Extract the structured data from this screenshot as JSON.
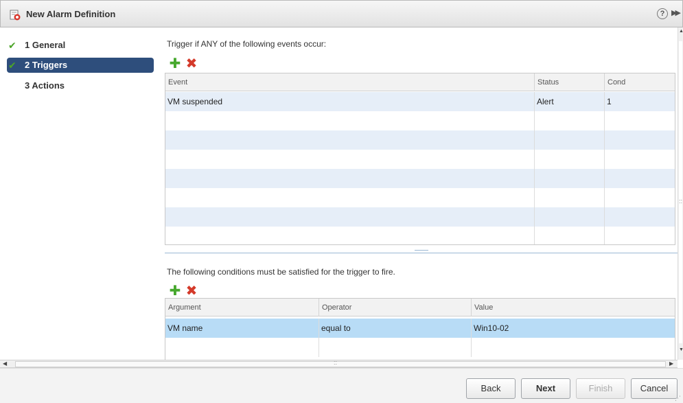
{
  "window": {
    "title": "New Alarm Definition",
    "help_glyph": "?",
    "expand_glyph": "▶▶"
  },
  "nav": {
    "items": [
      {
        "number": "1",
        "label": "1 General",
        "completed": true,
        "selected": false
      },
      {
        "number": "2",
        "label": "2 Triggers",
        "completed": true,
        "selected": true
      },
      {
        "number": "3",
        "label": "3 Actions",
        "completed": false,
        "selected": false
      }
    ],
    "check_glyph": "✔"
  },
  "triggers": {
    "heading": "Trigger if ANY of the following events occur:",
    "columns": [
      "Event",
      "Status",
      "Cond"
    ],
    "rows": [
      {
        "event": "VM suspended",
        "status": "Alert",
        "cond": "1"
      },
      {
        "event": "",
        "status": "",
        "cond": ""
      },
      {
        "event": "",
        "status": "",
        "cond": ""
      },
      {
        "event": "",
        "status": "",
        "cond": ""
      },
      {
        "event": "",
        "status": "",
        "cond": ""
      },
      {
        "event": "",
        "status": "",
        "cond": ""
      },
      {
        "event": "",
        "status": "",
        "cond": ""
      },
      {
        "event": "",
        "status": "",
        "cond": ""
      }
    ]
  },
  "conditions": {
    "heading": "The following conditions must be satisfied for the trigger to fire.",
    "columns": [
      "Argument",
      "Operator",
      "Value"
    ],
    "rows": [
      {
        "argument": "VM name",
        "operator": "equal to",
        "value": "Win10-02",
        "selected": true
      },
      {
        "argument": "",
        "operator": "",
        "value": "",
        "selected": false
      }
    ]
  },
  "toolbar": {
    "add_glyph": "✚",
    "delete_glyph": "✖"
  },
  "footer": {
    "back_label": "Back",
    "next_label": "Next",
    "finish_label": "Finish",
    "cancel_label": "Cancel"
  },
  "colors": {
    "accent": "#2e4e7c",
    "check": "#4ca428",
    "add": "#47a82e",
    "delete": "#d43a2a",
    "row_alt": "#e6eef8",
    "row_selected": "#b8dcf6"
  }
}
